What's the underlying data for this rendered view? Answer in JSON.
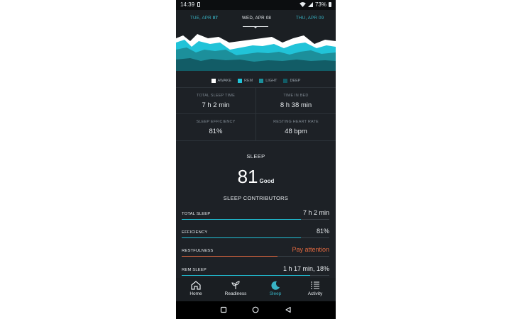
{
  "status_bar": {
    "time": "14:39",
    "battery": "73%"
  },
  "dates": {
    "prev_dow": "TUE, APR",
    "prev_num": "07",
    "curr": "WED, APR 08",
    "next": "THU, APR 09"
  },
  "legend": [
    {
      "label": "AWAKE",
      "color": "#ffffff"
    },
    {
      "label": "REM",
      "color": "#21c3d8"
    },
    {
      "label": "LIGHT",
      "color": "#1c8f9b"
    },
    {
      "label": "DEEP",
      "color": "#125c66"
    }
  ],
  "stats": [
    {
      "label": "TOTAL SLEEP TIME",
      "value": "7 h 2 min"
    },
    {
      "label": "TIME IN BED",
      "value": "8 h 38 min"
    },
    {
      "label": "SLEEP EFFICIENCY",
      "value": "81%"
    },
    {
      "label": "RESTING HEART RATE",
      "value": "48 bpm"
    }
  ],
  "sleep": {
    "heading": "SLEEP",
    "score": "81",
    "rating": "Good",
    "contributors_heading": "SLEEP CONTRIBUTORS"
  },
  "contributors": [
    {
      "label": "TOTAL SLEEP",
      "value": "7 h 2 min",
      "level": 0.81,
      "color": "#21c3d8",
      "value_color": "#e8ecef"
    },
    {
      "label": "EFFICIENCY",
      "value": "81%",
      "level": 0.81,
      "color": "#21c3d8",
      "value_color": "#e8ecef"
    },
    {
      "label": "RESTFULNESS",
      "value": "Pay attention",
      "level": 0.65,
      "color": "#e0683f",
      "value_color": "#e0683f"
    },
    {
      "label": "REM SLEEP",
      "value": "1 h 17 min, 18%",
      "level": 0.87,
      "color": "#21c3d8",
      "value_color": "#e8ecef"
    }
  ],
  "nav": [
    {
      "label": "Home",
      "icon": "home-icon"
    },
    {
      "label": "Readiness",
      "icon": "sprout-icon"
    },
    {
      "label": "Sleep",
      "icon": "moon-icon",
      "active": true
    },
    {
      "label": "Activity",
      "icon": "activity-list-icon"
    }
  ]
}
